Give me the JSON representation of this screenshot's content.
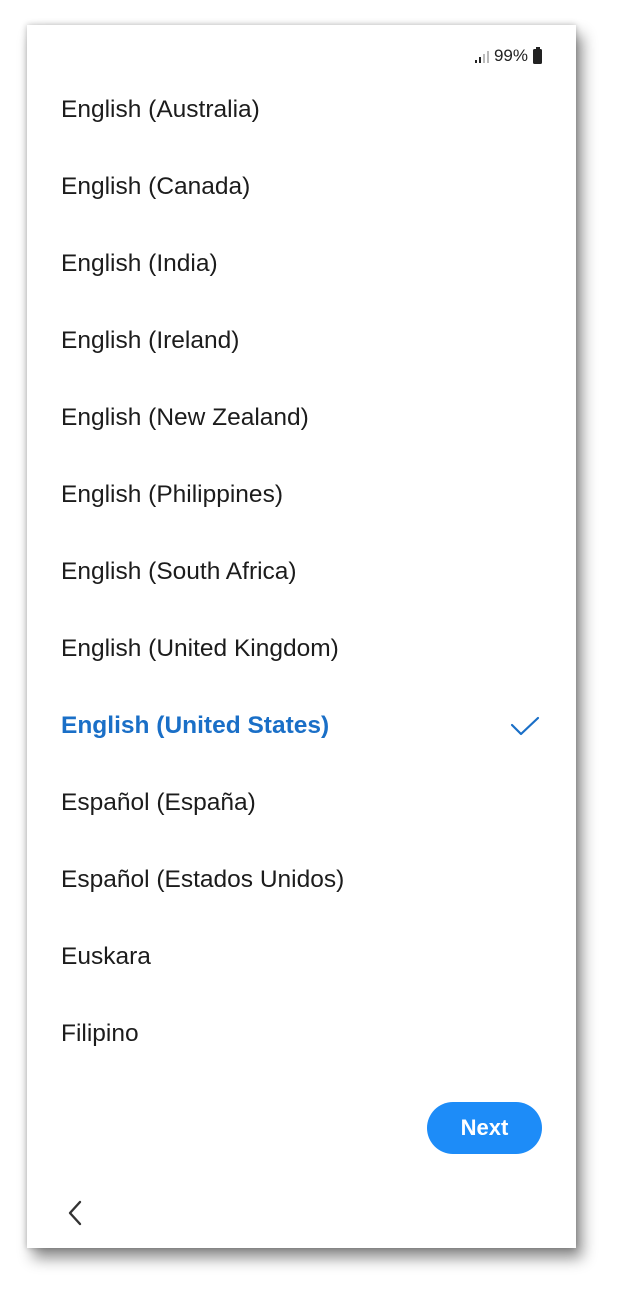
{
  "status_bar": {
    "battery_text": "99%",
    "signal_icon": "signal-icon",
    "battery_icon": "battery-icon"
  },
  "languages": [
    {
      "label": "English (Australia)"
    },
    {
      "label": "English (Canada)"
    },
    {
      "label": "English (India)"
    },
    {
      "label": "English (Ireland)"
    },
    {
      "label": "English (New Zealand)"
    },
    {
      "label": "English (Philippines)"
    },
    {
      "label": "English (South Africa)"
    },
    {
      "label": "English (United Kingdom)"
    },
    {
      "label": "English (United States)",
      "selected": true
    },
    {
      "label": "Español (España)"
    },
    {
      "label": "Español (Estados Unidos)"
    },
    {
      "label": "Euskara"
    },
    {
      "label": "Filipino"
    }
  ],
  "selected_language": "English (United States)",
  "actions": {
    "next_label": "Next",
    "back_icon": "chevron-left-icon"
  },
  "colors": {
    "accent": "#1d8cf8",
    "selected_text": "#1a6fc7",
    "text": "#1c1c1c"
  }
}
